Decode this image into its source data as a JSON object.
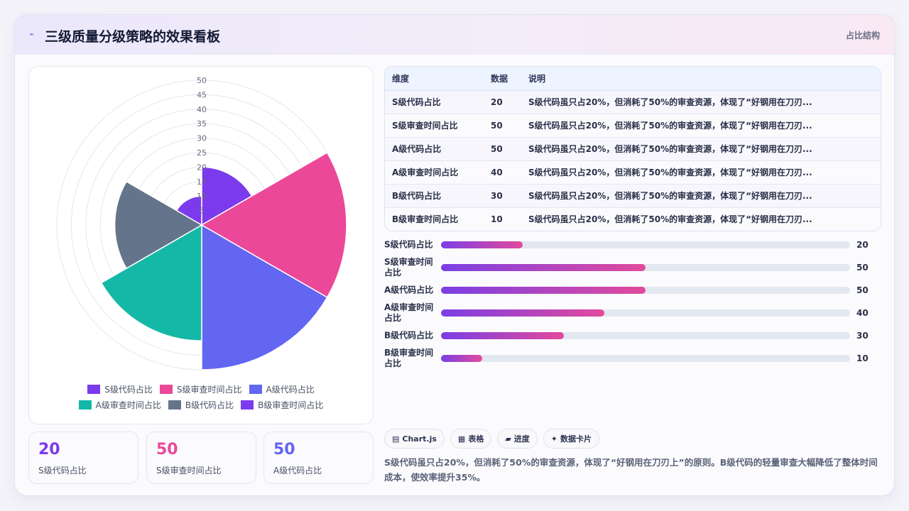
{
  "header": {
    "title": "三级质量分级策略的效果看板",
    "tag": "占比结构",
    "icon": "chart-line-icon"
  },
  "chart_data": {
    "type": "polarArea",
    "categories": [
      "S级代码占比",
      "S级审查时间占比",
      "A级代码占比",
      "A级审查时间占比",
      "B级代码占比",
      "B级审查时间占比"
    ],
    "values": [
      20,
      50,
      50,
      40,
      30,
      10
    ],
    "colors": [
      "#7c3aed",
      "#ec4899",
      "#6366f1",
      "#14b8a6",
      "#64748b",
      "#7c3aed"
    ],
    "rlim": [
      0,
      50
    ],
    "ticks": [
      "5",
      "10",
      "15",
      "20",
      "25",
      "30",
      "35",
      "40",
      "45",
      "50"
    ],
    "legend_position": "bottom",
    "grid": true
  },
  "kpis": [
    {
      "value": "20",
      "label": "S级代码占比",
      "color": "#7c3aed"
    },
    {
      "value": "50",
      "label": "S级审查时间占比",
      "color": "#ec4899"
    },
    {
      "value": "50",
      "label": "A级代码占比",
      "color": "#6366f1"
    }
  ],
  "table": {
    "headers": [
      "维度",
      "数据",
      "说明"
    ],
    "rows": [
      [
        "S级代码占比",
        "20",
        "S级代码虽只占20%，但消耗了50%的审查资源，体现了“好钢用在刀刃..."
      ],
      [
        "S级审查时间占比",
        "50",
        "S级代码虽只占20%，但消耗了50%的审查资源，体现了“好钢用在刀刃..."
      ],
      [
        "A级代码占比",
        "50",
        "S级代码虽只占20%，但消耗了50%的审查资源，体现了“好钢用在刀刃..."
      ],
      [
        "A级审查时间占比",
        "40",
        "S级代码虽只占20%，但消耗了50%的审查资源，体现了“好钢用在刀刃..."
      ],
      [
        "B级代码占比",
        "30",
        "S级代码虽只占20%，但消耗了50%的审查资源，体现了“好钢用在刀刃..."
      ],
      [
        "B级审查时间占比",
        "10",
        "S级代码虽只占20%，但消耗了50%的审查资源，体现了“好钢用在刀刃..."
      ]
    ]
  },
  "bars": {
    "max": 100,
    "items": [
      {
        "label": "S级代码占比",
        "value": 20
      },
      {
        "label": "S级审查时间占比",
        "value": 50
      },
      {
        "label": "A级代码占比",
        "value": 50
      },
      {
        "label": "A级审查时间占比",
        "value": 40
      },
      {
        "label": "B级代码占比",
        "value": 30
      },
      {
        "label": "B级审查时间占比",
        "value": 10
      }
    ]
  },
  "chips": [
    {
      "icon": "▤",
      "label": "Chart.js"
    },
    {
      "icon": "▦",
      "label": "表格"
    },
    {
      "icon": "▰",
      "label": "进度"
    },
    {
      "icon": "✦",
      "label": "数据卡片"
    }
  ],
  "summary": "S级代码虽只占20%，但消耗了50%的审查资源，体现了“好钢用在刀刃上”的原则。B级代码的轻量审查大幅降低了整体时间成本，使效率提升35%。"
}
